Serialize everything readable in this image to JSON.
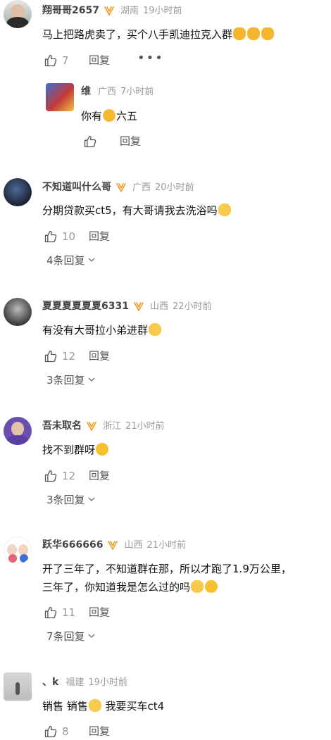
{
  "comments": [
    {
      "name": "翔哥哥2657",
      "loc": "湖南",
      "time": "19小时前",
      "text": "马上把路虎卖了，买个八手凯迪拉克入群",
      "likes": "7",
      "reply_label": "回复",
      "more": "•••",
      "sub": {
        "name": "维",
        "loc": "广西",
        "time": "7小时前",
        "text_pre": "你有",
        "text_post": "六五",
        "reply_label": "回复"
      }
    },
    {
      "name": "不知道叫什么哥",
      "loc": "广西",
      "time": "20小时前",
      "text": "分期贷款买ct5，有大哥请我去洗浴吗",
      "likes": "10",
      "reply_label": "回复",
      "replies": "4条回复"
    },
    {
      "name": "夏夏夏夏夏夏6331",
      "loc": "山西",
      "time": "22小时前",
      "text": "有没有大哥拉小弟进群",
      "likes": "12",
      "reply_label": "回复",
      "replies": "3条回复"
    },
    {
      "name": "吾未取名",
      "loc": "浙江",
      "time": "21小时前",
      "text": "找不到群呀",
      "likes": "12",
      "reply_label": "回复",
      "replies": "3条回复"
    },
    {
      "name": "跃华666666",
      "loc": "山西",
      "time": "21小时前",
      "text1": "开了三年了，不知道群在那，所以才跑了1.9万公里，",
      "text2": "三年了，你知道我是怎么过的吗",
      "likes": "11",
      "reply_label": "回复",
      "replies": "7条回复"
    },
    {
      "name": "、k",
      "loc": "福建",
      "time": "19小时前",
      "text_pre": "销售 销售",
      "text_post": " 我要买车ct4",
      "likes": "8",
      "reply_label": "回复"
    }
  ],
  "icons": {
    "like": "thumbs-up-icon",
    "badge": "v-badge-icon",
    "chevron": "chevron-down-icon"
  },
  "colors": {
    "badge": "#f0a030",
    "secondary": "#999999",
    "text": "#111111"
  }
}
